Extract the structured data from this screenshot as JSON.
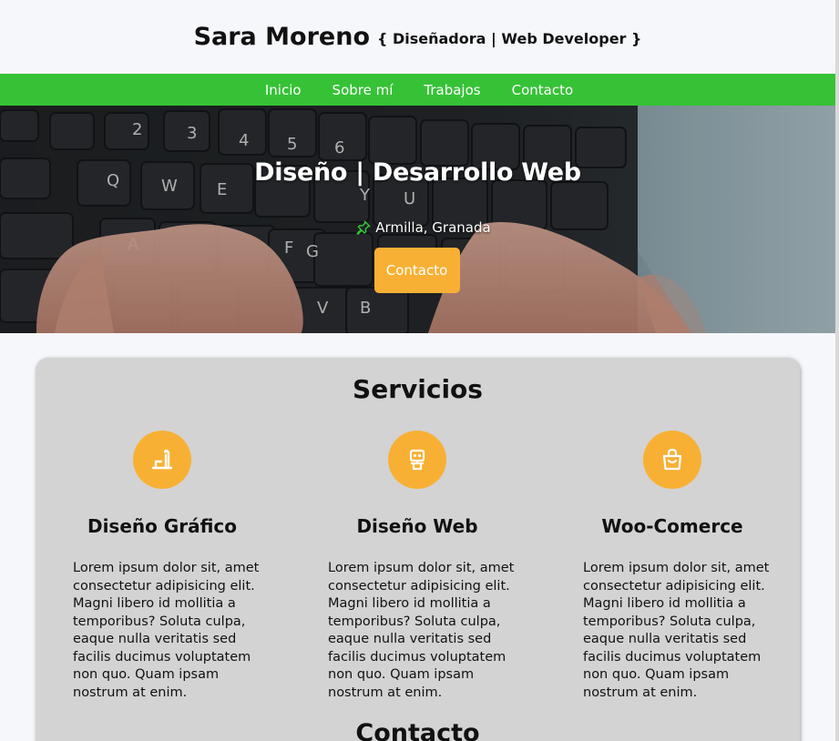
{
  "header": {
    "name": "Sara Moreno",
    "tagline": "{ Diseñadora | Web Developer }"
  },
  "nav": {
    "items": [
      "Inicio",
      "Sobre mí",
      "Trabajos",
      "Contacto"
    ]
  },
  "hero": {
    "title": "Diseño | Desarrollo Web",
    "location": "Armilla, Granada",
    "button_label": "Contacto",
    "location_icon": "pushpin-icon"
  },
  "services": {
    "title": "Servicios",
    "items": [
      {
        "icon": "pencil-ruler-icon",
        "title": "Diseño Gráfico",
        "text": "Lorem ipsum dolor sit, amet consectetur adipisicing elit. Magni libero id mollitia a temporibus? Soluta culpa, eaque nulla veritatis sed facilis ducimus voluptatem non quo. Quam ipsam nostrum at enim."
      },
      {
        "icon": "robot-icon",
        "title": "Diseño Web",
        "text": "Lorem ipsum dolor sit, amet consectetur adipisicing elit. Magni libero id mollitia a temporibus? Soluta culpa, eaque nulla veritatis sed facilis ducimus voluptatem non quo. Quam ipsam nostrum at enim."
      },
      {
        "icon": "shopping-bag-icon",
        "title": "Woo-Comerce",
        "text": "Lorem ipsum dolor sit, amet consectetur adipisicing elit. Magni libero id mollitia a temporibus? Soluta culpa, eaque nulla veritatis sed facilis ducimus voluptatem non quo. Quam ipsam nostrum at enim."
      }
    ]
  },
  "contact": {
    "title": "Contacto"
  },
  "colors": {
    "nav_green": "#36c236",
    "accent_orange": "#f8b034",
    "card_gray": "#d3d3d3",
    "page_bg": "#f6f7fb"
  }
}
